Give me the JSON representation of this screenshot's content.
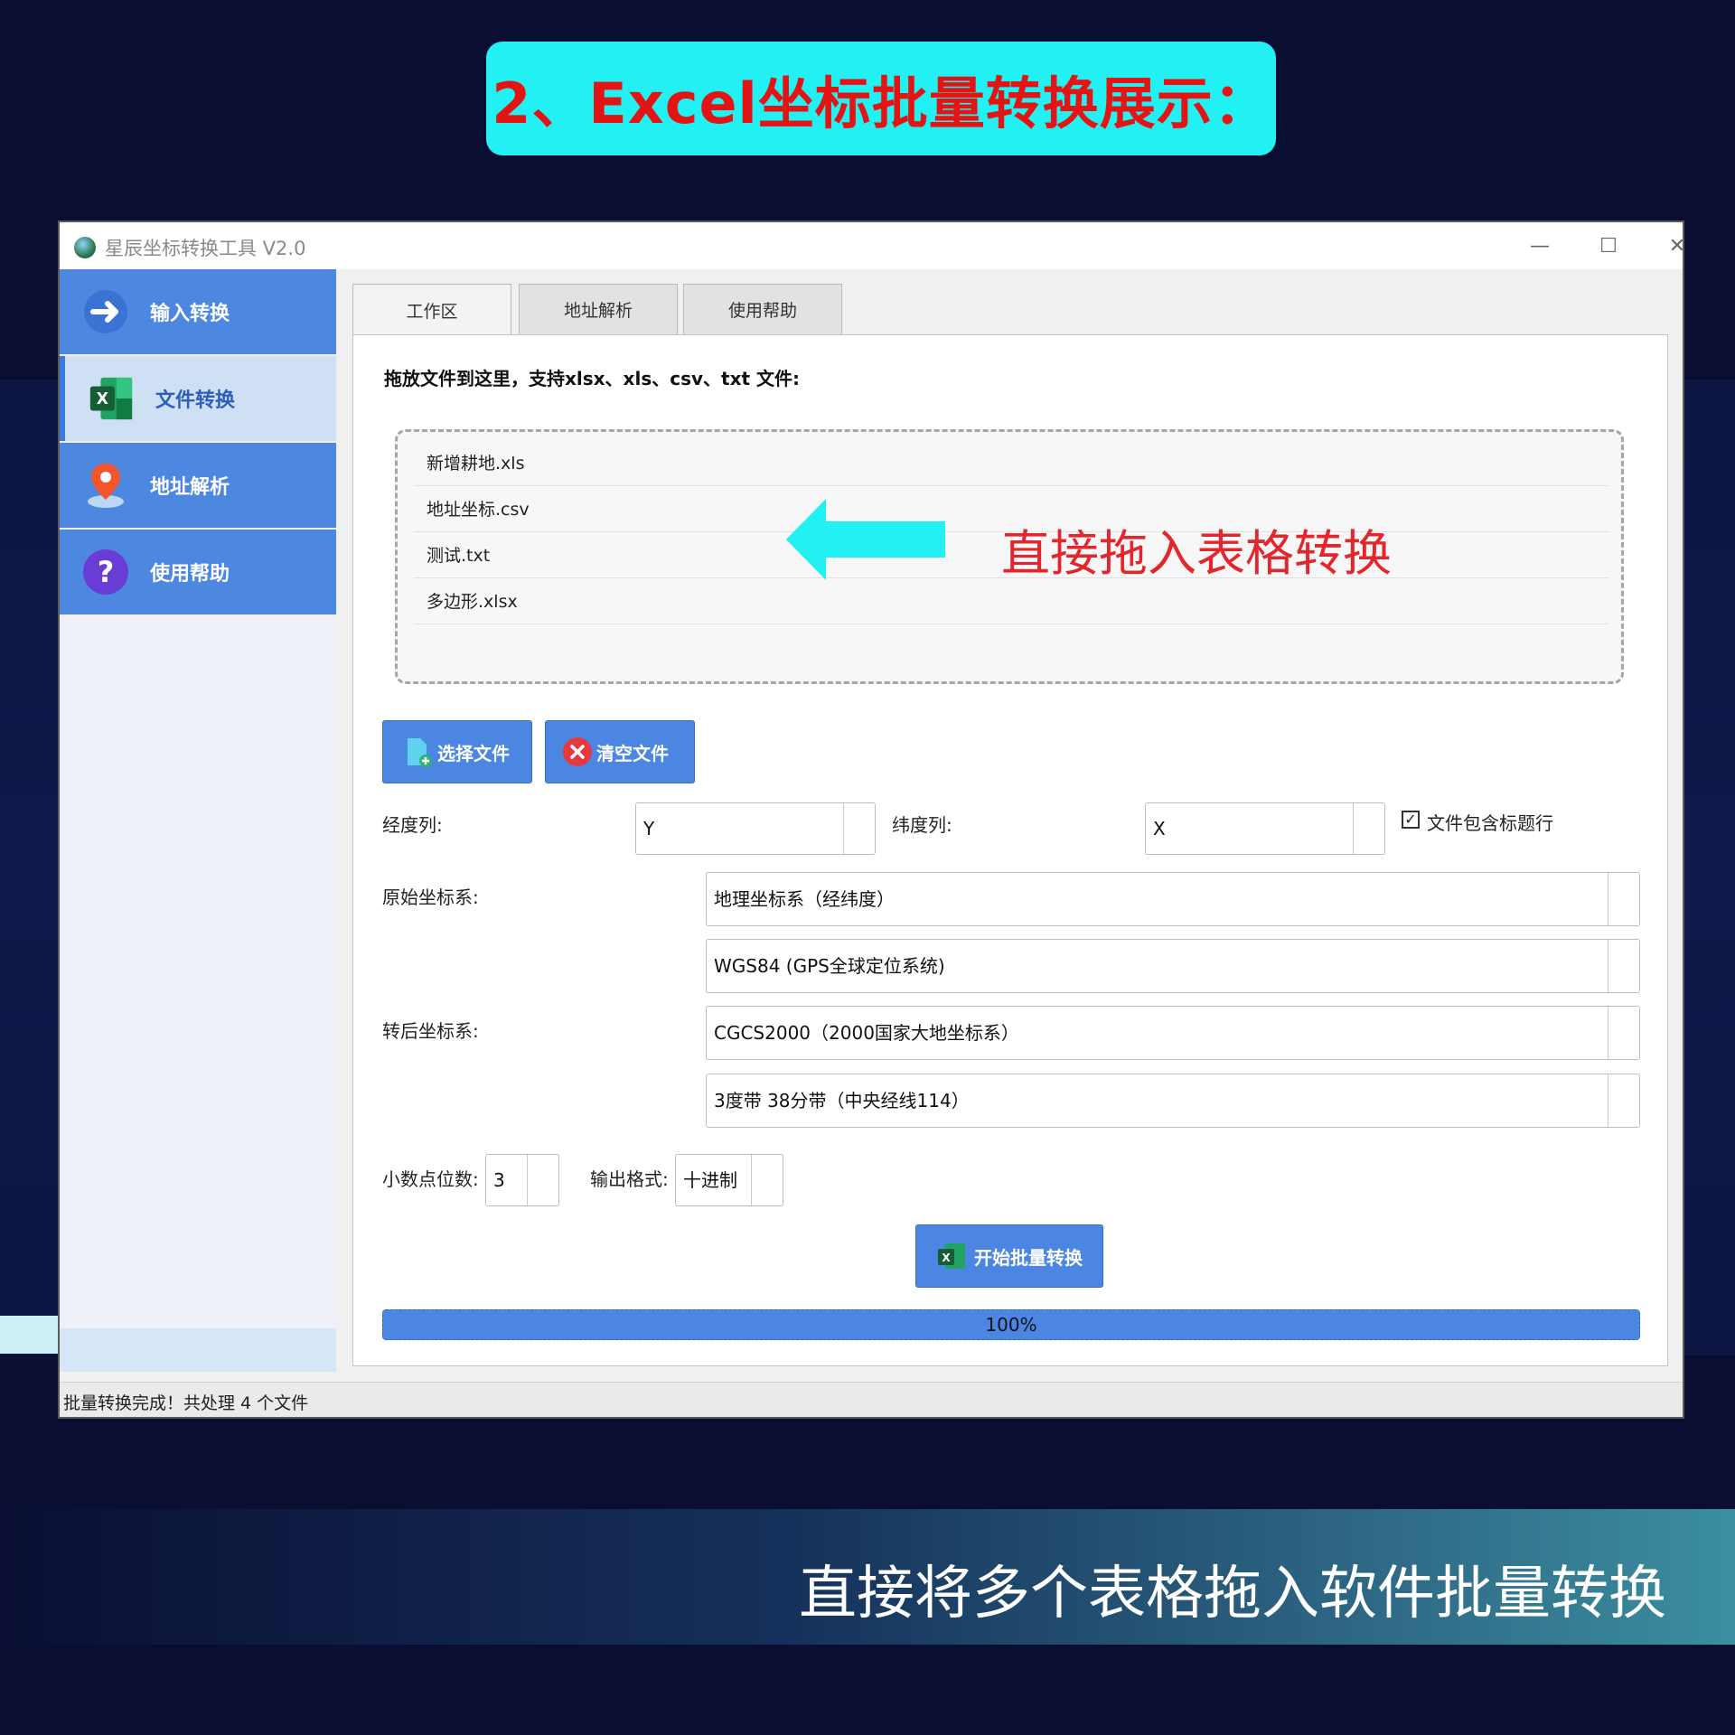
{
  "slide": {
    "title": "2、Excel坐标批量转换展示：",
    "caption": "直接将多个表格拖入软件批量转换",
    "annotation": "直接拖入表格转换",
    "accent_color": "#22f1f4",
    "title_color": "#e41414"
  },
  "window": {
    "title": "星辰坐标转换工具 V2.0",
    "controls": {
      "minimize": "—",
      "maximize": "☐",
      "close": "✕"
    }
  },
  "sidebar": {
    "items": [
      {
        "label": "输入转换",
        "icon": "arrow-right-icon"
      },
      {
        "label": "文件转换",
        "icon": "excel-icon",
        "active": true
      },
      {
        "label": "地址解析",
        "icon": "map-pin-icon"
      },
      {
        "label": "使用帮助",
        "icon": "help-icon"
      }
    ]
  },
  "tabs": [
    {
      "label": "工作区",
      "active": true
    },
    {
      "label": "地址解析"
    },
    {
      "label": "使用帮助"
    }
  ],
  "workspace": {
    "drop_hint": "拖放文件到这里，支持xlsx、xls、csv、txt 文件:",
    "files": [
      "新增耕地.xls",
      "地址坐标.csv",
      "测试.txt",
      "多边形.xlsx"
    ],
    "select_button": "选择文件",
    "clear_button": "清空文件",
    "lon_label": "经度列:",
    "lon_value": "Y",
    "lat_label": "纬度列:",
    "lat_value": "X",
    "header_checkbox_label": "文件包含标题行",
    "header_checked": true,
    "source_label": "原始坐标系:",
    "source_type": "地理坐标系（经纬度）",
    "source_datum": "WGS84 (GPS全球定位系统)",
    "target_label": "转后坐标系:",
    "target_datum": "CGCS2000（2000国家大地坐标系）",
    "target_zone": "3度带 38分带（中央经线114）",
    "decimals_label": "小数点位数:",
    "decimals_value": "3",
    "format_label": "输出格式:",
    "format_value": "十进制",
    "start_button": "开始批量转换",
    "progress_percent": 100,
    "progress_text": "100%"
  },
  "status": "批量转换完成！共处理 4 个文件"
}
